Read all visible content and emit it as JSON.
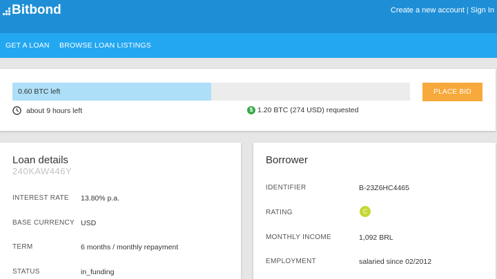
{
  "header": {
    "logo_text": "Bitbond",
    "create_account": "Create a new account",
    "separator": "|",
    "sign_in": "Sign In"
  },
  "nav": {
    "items": [
      {
        "label": "GET A LOAN"
      },
      {
        "label": "BROWSE LOAN LISTINGS"
      }
    ]
  },
  "bid": {
    "progress_text": "0.60 BTC left",
    "progress_fraction": 0.5,
    "button_label": "PLACE BID",
    "time_left": "about 9 hours left",
    "requested": "1.20 BTC (274 USD) requested",
    "dollar_symbol": "$"
  },
  "loan_details": {
    "title": "Loan details",
    "loan_id": "240KAW446Y",
    "rows": [
      {
        "label": "INTEREST RATE",
        "value": "13.80% p.a."
      },
      {
        "label": "BASE CURRENCY",
        "value": "USD"
      },
      {
        "label": "TERM",
        "value": "6 months / monthly repayment"
      },
      {
        "label": "STATUS",
        "value": "in_funding"
      }
    ]
  },
  "borrower": {
    "title": "Borrower",
    "rows": [
      {
        "label": "IDENTIFIER",
        "value": "B-23Z6HC4465"
      },
      {
        "label": "RATING",
        "value": "C"
      },
      {
        "label": "MONTHLY INCOME",
        "value": "1,092 BRL"
      },
      {
        "label": "EMPLOYMENT",
        "value": "salaried since 02/2012"
      }
    ]
  },
  "colors": {
    "header_bg": "#1e8fd6",
    "nav_bg": "#23a7f0",
    "progress_fill": "#aedff8",
    "bid_button": "#f7a93b",
    "rating_badge": "#c5d733",
    "dollar_icon": "#3aa84a"
  }
}
